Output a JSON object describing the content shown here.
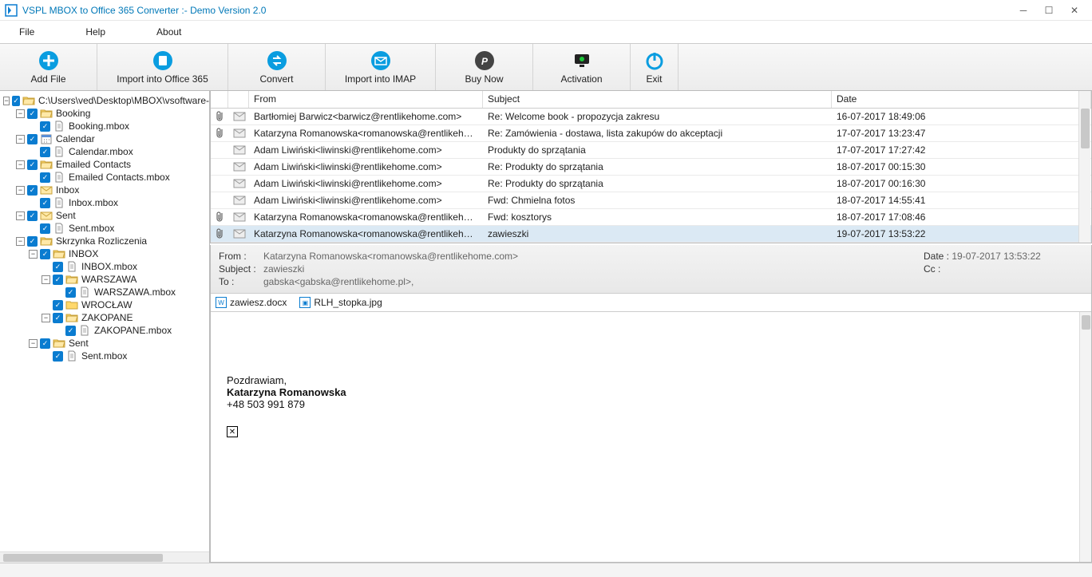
{
  "titlebar": {
    "title": "VSPL MBOX to Office 365 Converter  :-  Demo Version 2.0"
  },
  "menu": {
    "file": "File",
    "help": "Help",
    "about": "About"
  },
  "toolbar": {
    "add_file": "Add File",
    "import_o365": "Import into Office 365",
    "convert": "Convert",
    "import_imap": "Import into IMAP",
    "buy_now": "Buy Now",
    "activation": "Activation",
    "exit": "Exit"
  },
  "tree": [
    {
      "indent": 0,
      "toggle": "-",
      "icon": "folder-open",
      "label": "C:\\Users\\ved\\Desktop\\MBOX\\vsoftware-"
    },
    {
      "indent": 1,
      "toggle": "-",
      "icon": "folder-open",
      "label": "Booking"
    },
    {
      "indent": 2,
      "toggle": "",
      "icon": "file",
      "label": "Booking.mbox"
    },
    {
      "indent": 1,
      "toggle": "-",
      "icon": "calendar",
      "label": "Calendar"
    },
    {
      "indent": 2,
      "toggle": "",
      "icon": "file",
      "label": "Calendar.mbox"
    },
    {
      "indent": 1,
      "toggle": "-",
      "icon": "folder-open",
      "label": "Emailed Contacts"
    },
    {
      "indent": 2,
      "toggle": "",
      "icon": "file",
      "label": "Emailed Contacts.mbox"
    },
    {
      "indent": 1,
      "toggle": "-",
      "icon": "mail",
      "label": "Inbox"
    },
    {
      "indent": 2,
      "toggle": "",
      "icon": "file",
      "label": "Inbox.mbox"
    },
    {
      "indent": 1,
      "toggle": "-",
      "icon": "mail",
      "label": "Sent"
    },
    {
      "indent": 2,
      "toggle": "",
      "icon": "file",
      "label": "Sent.mbox"
    },
    {
      "indent": 1,
      "toggle": "-",
      "icon": "folder-open",
      "label": "Skrzynka Rozliczenia"
    },
    {
      "indent": 2,
      "toggle": "-",
      "icon": "folder-open",
      "label": "INBOX"
    },
    {
      "indent": 3,
      "toggle": "",
      "icon": "file",
      "label": "INBOX.mbox"
    },
    {
      "indent": 3,
      "toggle": "-",
      "icon": "folder-open",
      "label": "WARSZAWA"
    },
    {
      "indent": 4,
      "toggle": "",
      "icon": "file",
      "label": "WARSZAWA.mbox"
    },
    {
      "indent": 3,
      "toggle": "",
      "icon": "folder",
      "label": "WROCŁAW"
    },
    {
      "indent": 3,
      "toggle": "-",
      "icon": "folder-open",
      "label": "ZAKOPANE"
    },
    {
      "indent": 4,
      "toggle": "",
      "icon": "file",
      "label": "ZAKOPANE.mbox"
    },
    {
      "indent": 2,
      "toggle": "-",
      "icon": "folder-open",
      "label": "Sent"
    },
    {
      "indent": 3,
      "toggle": "",
      "icon": "file",
      "label": "Sent.mbox"
    }
  ],
  "grid": {
    "headers": {
      "from": "From",
      "subject": "Subject",
      "date": "Date"
    },
    "rows": [
      {
        "attach": true,
        "from": "Bartłomiej Barwicz<barwicz@rentlikehome.com>",
        "subject": "Re: Welcome book - propozycja zakresu",
        "date": "16-07-2017 18:49:06"
      },
      {
        "attach": true,
        "from": "Katarzyna Romanowska<romanowska@rentlikehome.com>",
        "subject": "Re: Zamówienia - dostawa, lista zakupów do akceptacji",
        "date": "17-07-2017 13:23:47"
      },
      {
        "attach": false,
        "from": "Adam Liwiński<liwinski@rentlikehome.com>",
        "subject": "Produkty do sprzątania",
        "date": "17-07-2017 17:27:42"
      },
      {
        "attach": false,
        "from": "Adam Liwiński<liwinski@rentlikehome.com>",
        "subject": "Re: Produkty do sprzątania",
        "date": "18-07-2017 00:15:30"
      },
      {
        "attach": false,
        "from": "Adam Liwiński<liwinski@rentlikehome.com>",
        "subject": "Re: Produkty do sprzątania",
        "date": "18-07-2017 00:16:30"
      },
      {
        "attach": false,
        "from": "Adam Liwiński<liwinski@rentlikehome.com>",
        "subject": "Fwd: Chmielna fotos",
        "date": "18-07-2017 14:55:41"
      },
      {
        "attach": true,
        "from": "Katarzyna Romanowska<romanowska@rentlikehome.com>",
        "subject": "Fwd: kosztorys",
        "date": "18-07-2017 17:08:46"
      },
      {
        "attach": true,
        "from": "Katarzyna Romanowska<romanowska@rentlikehome.com>",
        "subject": "zawieszki",
        "date": "19-07-2017 13:53:22",
        "selected": true
      }
    ]
  },
  "preview": {
    "from_label": "From :",
    "from": "Katarzyna Romanowska<romanowska@rentlikehome.com>",
    "subject_label": "Subject :",
    "subject": "zawieszki",
    "to_label": "To :",
    "to": "gabska<gabska@rentlikehome.pl>,",
    "date_label": "Date :",
    "date": "19-07-2017 13:53:22",
    "cc_label": "Cc :",
    "cc": "",
    "attachments": [
      {
        "icon": "W",
        "name": "zawiesz.docx"
      },
      {
        "icon": "▣",
        "name": "RLH_stopka.jpg"
      }
    ],
    "body": {
      "greeting": "Pozdrawiam,",
      "name": "Katarzyna Romanowska",
      "phone": "+48 503 991 879"
    }
  }
}
